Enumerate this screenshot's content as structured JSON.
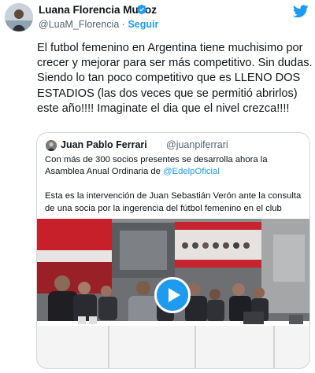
{
  "author": {
    "name": "Luana Florencia Muñoz",
    "handle": "@LuaM_Florencia",
    "separator": " · ",
    "follow_label": "Seguir",
    "avatar_icon": "profile-photo",
    "verified_icon": "verified-badge-icon"
  },
  "platform_icon": "twitter-bird-icon",
  "tweet": {
    "text": "El futbol femenino en Argentina tiene muchisimo por crecer y mejorar para ser más competitivo. Sin dudas. Siendo lo tan poco competitivo que es LLENO DOS ESTADIOS (las dos veces que se permitió abrirlos) este año!!!! Imaginate el dia que el nivel crezca!!!!"
  },
  "quoted_tweet": {
    "name": "Juan Pablo Ferrari",
    "handle": "@juanpiferrari",
    "text_part1": "Con más de 300 socios presentes se desarrolla ahora la Asamblea Anual Ordinaria de ",
    "mention": "@EdelpOficial",
    "text_part2": "\n\nEsta es la intervención de Juan Sebastián Verón ante la consulta de una socia por la ingerencia del fútbol femenino en el club",
    "media": {
      "type": "video",
      "play_icon": "play-icon"
    }
  },
  "colors": {
    "accent": "#1d9bf0",
    "text": "#0f1419",
    "secondary_text": "#536471",
    "border": "#cfd9de"
  }
}
